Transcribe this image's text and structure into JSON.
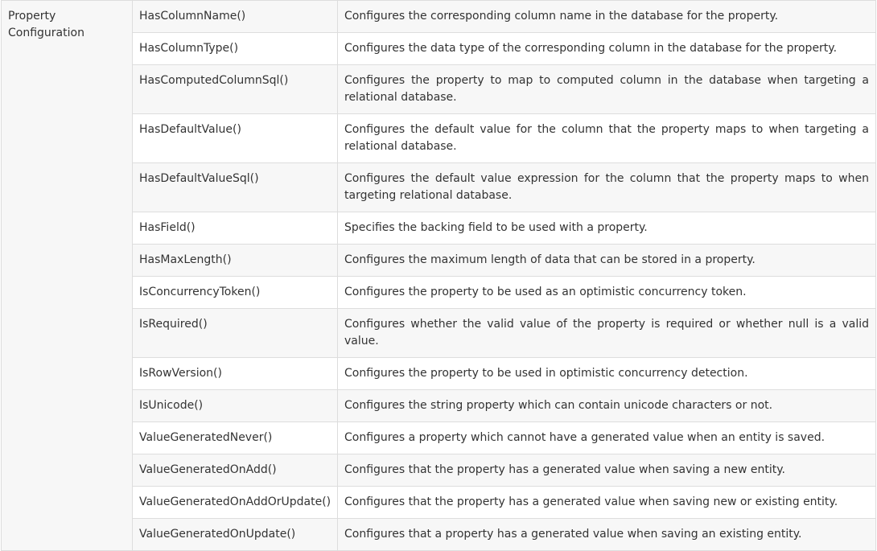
{
  "table": {
    "group_label": "Property Configuration",
    "rows": [
      {
        "method": "HasColumnName()",
        "description": "Configures the corresponding column name in the database for the property."
      },
      {
        "method": "HasColumnType()",
        "description": "Configures the data type of the corresponding column in the database for the property."
      },
      {
        "method": "HasComputedColumnSql()",
        "description": "Configures the property to map to computed column in the database when targeting a relational database."
      },
      {
        "method": "HasDefaultValue()",
        "description": "Configures the default value for the column that the property maps to when targeting a relational database."
      },
      {
        "method": "HasDefaultValueSql()",
        "description": "Configures the default value expression for the column that the property maps to when targeting relational database."
      },
      {
        "method": "HasField()",
        "description": "Specifies the backing field to be used with a property."
      },
      {
        "method": "HasMaxLength()",
        "description": "Configures the maximum length of data that can be stored in a property."
      },
      {
        "method": "IsConcurrencyToken()",
        "description": "Configures the property to be used as an optimistic concurrency token."
      },
      {
        "method": "IsRequired()",
        "description": "Configures whether the valid value of the property is required or whether null is a valid value."
      },
      {
        "method": "IsRowVersion()",
        "description": "Configures the property to be used in optimistic concurrency detection."
      },
      {
        "method": "IsUnicode()",
        "description": "Configures the string property which can contain unicode characters or not."
      },
      {
        "method": "ValueGeneratedNever()",
        "description": "Configures a property which cannot have a generated value when an entity is saved."
      },
      {
        "method": "ValueGeneratedOnAdd()",
        "description": "Configures that the property has a generated value when saving a new entity."
      },
      {
        "method": "ValueGeneratedOnAddOrUpdate()",
        "description": "Configures that the property has a generated value when saving new or existing entity."
      },
      {
        "method": "ValueGeneratedOnUpdate()",
        "description": "Configures that a property has a generated value when saving an existing entity."
      }
    ]
  }
}
